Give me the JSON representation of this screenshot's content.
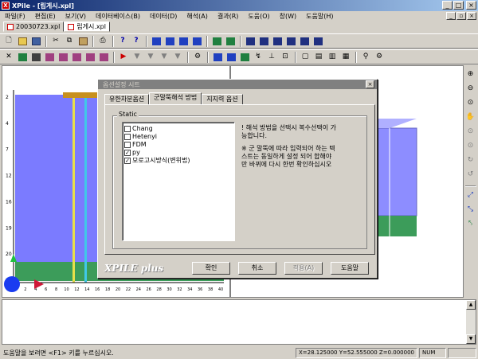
{
  "app": {
    "title": "XPile - [립게시.xpl]",
    "icon": "X"
  },
  "menu": [
    "파일(F)",
    "편집(E)",
    "보기(V)",
    "데이터베이스(B)",
    "데이터(D)",
    "해석(A)",
    "결과(R)",
    "도움(O)",
    "창(W)",
    "도움말(H)"
  ],
  "doc_tabs": [
    {
      "label": "20030723.xpl",
      "active": false
    },
    {
      "label": "립게시.xpl",
      "active": true
    }
  ],
  "status_bar": {
    "message": "도움말을 보려면 <F1> 키를 누르십시오.",
    "coords": "X=28.125000 Y=52.555000 Z=0.000000",
    "num": "NUM"
  },
  "canvas": {
    "y_ticks": [
      "2",
      "4",
      "7",
      "12",
      "16",
      "19",
      "20",
      "33"
    ],
    "x_ticks": [
      "0",
      "2",
      "4",
      "6",
      "8",
      "10",
      "12",
      "14",
      "16",
      "18",
      "20",
      "22",
      "24",
      "26",
      "28",
      "30",
      "32",
      "34",
      "36",
      "38",
      "40"
    ],
    "colors": {
      "soil_blue": "#7b7bff",
      "ground_green": "#3c9c5a",
      "cap_orange": "#c8901e",
      "pile_yellow": "#e8e04a",
      "pile_cyan": "#40c8e8"
    }
  },
  "dialog": {
    "title": "옵션설정 시트",
    "tabs": [
      {
        "label": "유한차분옵션",
        "active": false
      },
      {
        "label": "군말뚝해석 방법",
        "active": true
      },
      {
        "label": "지지력 옵션",
        "active": false
      }
    ],
    "group_label": "Static",
    "methods": [
      {
        "label": "Chang",
        "checked": false
      },
      {
        "label": "Hetenyi",
        "checked": false
      },
      {
        "label": "FDM",
        "checked": false
      },
      {
        "label": "py",
        "checked": true
      },
      {
        "label": "모로고시방식(변위법)",
        "checked": true
      }
    ],
    "note_line1": "! 해석 방법을 선택시 복수선택이 가능합니다.",
    "note_line2": "※ 군 말뚝에 따라 입력되어 하는 텍스트는 동일하게 설정 되어 합해야만 바뀌에 다시 한번 확인하십시오",
    "logo": "XPILE plus",
    "buttons": [
      {
        "label": "확인",
        "enabled": true
      },
      {
        "label": "취소",
        "enabled": true
      },
      {
        "label": "적용(A)",
        "enabled": false
      },
      {
        "label": "도움말",
        "enabled": true
      }
    ]
  }
}
